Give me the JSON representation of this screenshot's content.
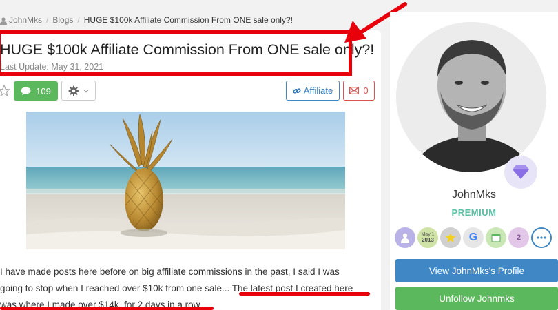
{
  "breadcrumb": {
    "items": [
      "JohnMks",
      "Blogs"
    ],
    "current": "HUGE $100k Affiliate Commission From ONE sale only?!"
  },
  "post": {
    "title": "HUGE $100k Affiliate Commission From ONE sale only?!",
    "last_update": "Last Update: May 31, 2021",
    "comment_count": "109",
    "affiliate_label": "Affiliate",
    "mail_count": "0",
    "body_lines": [
      "I have made posts here before on big affiliate commissions in the past, I said I was",
      "going to stop when I reached over $10k from one sale... The latest post I created here",
      "was where I made over $14k, for 2 days in a row..."
    ]
  },
  "profile": {
    "username": "JohnMks",
    "membership": "PREMIUM",
    "badges": [
      {
        "icon": "person-badge-icon",
        "color": "#b9b2e6"
      },
      {
        "icon": "calendar-badge-icon",
        "label_top": "May 1",
        "label_bottom": "2013",
        "color": "#cfe3a6"
      },
      {
        "icon": "star-badge-icon",
        "color": "#d0d0d0"
      },
      {
        "icon": "google-badge-icon",
        "color": "#e6e6e6"
      },
      {
        "icon": "calendar-green-badge-icon",
        "color": "#c9e8b5"
      },
      {
        "icon": "rank-badge-icon",
        "label": "2",
        "color": "#e3c7e9"
      },
      {
        "icon": "more-icon",
        "color": "#ffffff"
      }
    ],
    "view_profile_label": "View JohnMks's Profile",
    "unfollow_label": "Unfollow Johnmks"
  },
  "colors": {
    "annotation_red": "#e8000b",
    "success_green": "#5cb85c",
    "primary_blue": "#3f88c5",
    "premium_teal": "#5bc0a4"
  }
}
